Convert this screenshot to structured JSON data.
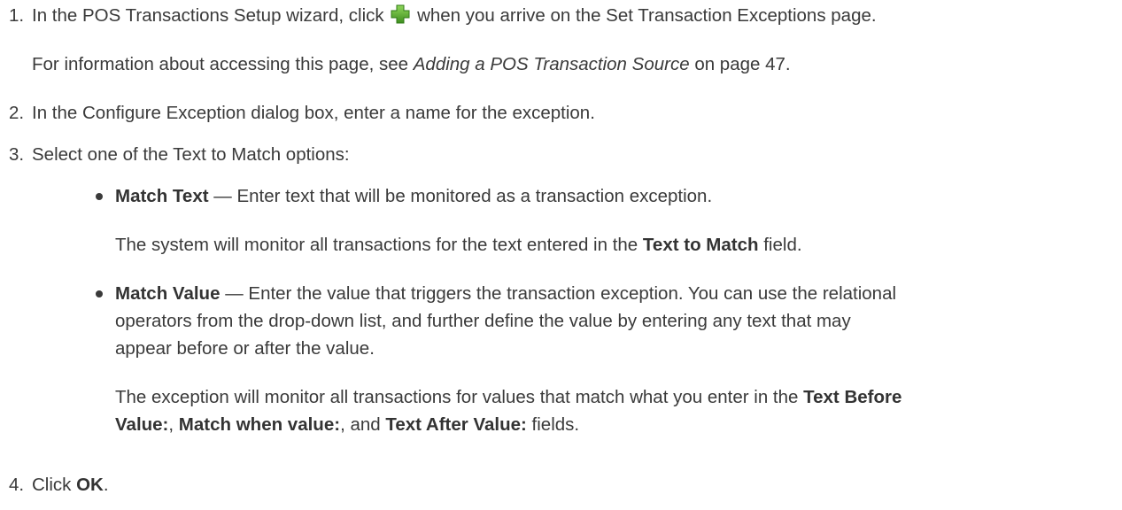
{
  "steps": [
    {
      "number": "1.",
      "text_before_icon": "In the POS Transactions Setup wizard, click",
      "icon": "green-plus-icon",
      "text_after_icon": "when you arrive on the Set Transaction Exceptions page.",
      "note_before": "For information about accessing this page, see",
      "note_link": "Adding a POS Transaction Source",
      "note_after": "on page 47."
    },
    {
      "number": "2.",
      "text": "In the Configure Exception dialog box, enter a name for the exception."
    },
    {
      "number": "3.",
      "text": "Select one of the Text to Match options:",
      "bullets": [
        {
          "term": "Match Text",
          "desc": " — Enter text that will be monitored as a transaction exception.",
          "detail_before": "The system will monitor all transactions for the text entered in the",
          "detail_bold": "Text to Match",
          "detail_after": "field."
        },
        {
          "term": "Match Value",
          "desc_line1": " — Enter the value that triggers the transaction exception. You can use the relational",
          "desc_line2": "operators from the drop-down list, and further define the value by entering any text that may",
          "desc_line3": "appear before or after the value.",
          "detail_line1_before": "The exception will monitor all transactions for values that match what you enter in the",
          "detail_bold1a": "Text Before",
          "detail_bold1b": "Value:",
          "detail_comma1": ", ",
          "detail_bold2": "Match when value:",
          "detail_mid": ", and ",
          "detail_bold3": "Text After Value:",
          "detail_end": " fields."
        }
      ]
    },
    {
      "number": "4.",
      "text_before": "Click ",
      "bold": "OK",
      "text_after": "."
    }
  ],
  "colors": {
    "text": "#3a3a3a",
    "icon_green": "#5aa832"
  }
}
